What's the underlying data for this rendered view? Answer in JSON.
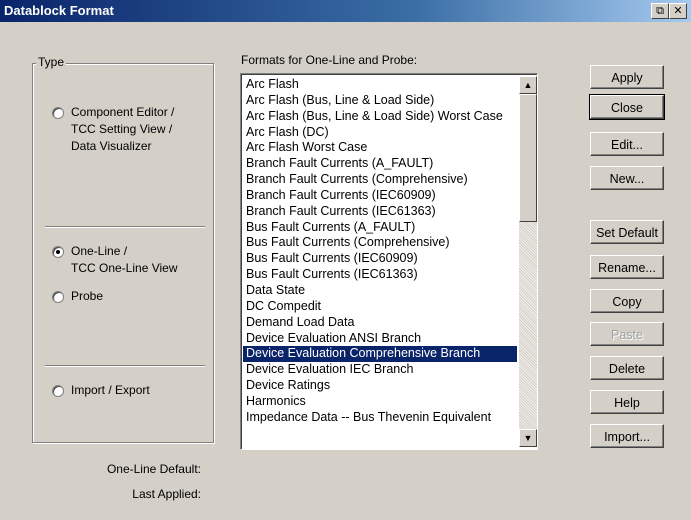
{
  "window": {
    "title": "Datablock Format",
    "restore_glyph": "⧉",
    "close_glyph": "✕"
  },
  "type_group": {
    "legend": "Type",
    "options": [
      {
        "label_lines": [
          "Component Editor /",
          "TCC Setting View /",
          "Data Visualizer"
        ],
        "checked": false
      },
      {
        "label_lines": [
          "One-Line /",
          "TCC One-Line View"
        ],
        "checked": true
      },
      {
        "label_lines": [
          "Probe"
        ],
        "checked": false
      },
      {
        "label_lines": [
          "Import / Export"
        ],
        "checked": false
      }
    ]
  },
  "formats": {
    "label": "Formats for One-Line and Probe:",
    "items": [
      "Arc Flash",
      "Arc Flash (Bus, Line & Load Side)",
      "Arc Flash (Bus, Line & Load Side) Worst Case",
      "Arc Flash (DC)",
      "Arc Flash Worst Case",
      "Branch Fault Currents (A_FAULT)",
      "Branch Fault Currents (Comprehensive)",
      "Branch Fault Currents (IEC60909)",
      "Branch Fault Currents (IEC61363)",
      "Bus Fault Currents (A_FAULT)",
      "Bus Fault Currents (Comprehensive)",
      "Bus Fault Currents (IEC60909)",
      "Bus Fault Currents (IEC61363)",
      "Data State",
      "DC Compedit",
      "Demand Load Data",
      "Device Evaluation ANSI Branch",
      "Device Evaluation Comprehensive Branch",
      "Device Evaluation IEC Branch",
      "Device Ratings",
      "Harmonics",
      "Impedance Data -- Bus Thevenin Equivalent"
    ],
    "selected_index": 17
  },
  "buttons": {
    "apply": "Apply",
    "close": "Close",
    "edit": "Edit...",
    "new": "New...",
    "set_default": "Set Default",
    "rename": "Rename...",
    "copy": "Copy",
    "paste": "Paste",
    "delete": "Delete",
    "help": "Help",
    "import": "Import..."
  },
  "footer": {
    "one_line_default_label": "One-Line Default:",
    "last_applied_label": "Last Applied:"
  },
  "colors": {
    "selection": "#0a246a",
    "dialog_bg": "#d4d0c8"
  }
}
